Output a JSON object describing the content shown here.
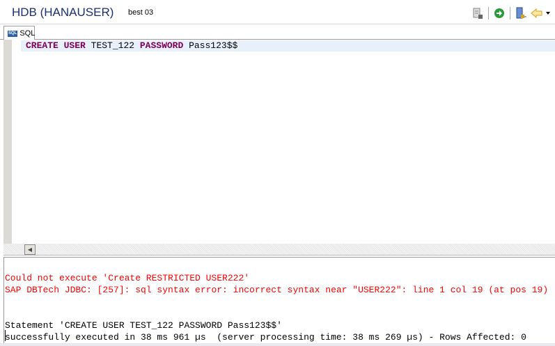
{
  "header": {
    "title": "HDB (HANAUSER)",
    "subtitle": "best 03"
  },
  "toolbar": {
    "icons": [
      "disconnect-icon",
      "execute-icon",
      "sql-console-icon",
      "back-icon",
      "dropdown-icon"
    ]
  },
  "tab": {
    "icon_label": "SQL",
    "label": "SQL"
  },
  "editor": {
    "tokens": [
      {
        "text": "CREATE",
        "kw": true
      },
      {
        "text": " "
      },
      {
        "text": "USER",
        "kw": true
      },
      {
        "text": " TEST_122 "
      },
      {
        "text": "PASSWORD",
        "kw": true
      },
      {
        "text": " Pass123$$"
      }
    ]
  },
  "console": {
    "lines": [
      {
        "text": "Could not execute 'Create RESTRICTED USER222'",
        "type": "err"
      },
      {
        "text": "SAP DBTech JDBC: [257]: sql syntax error: incorrect syntax near \"USER222\": line 1 col 19 (at pos 19)",
        "type": "err"
      },
      {
        "text": "",
        "type": "ok"
      },
      {
        "text": "",
        "type": "ok"
      },
      {
        "text": "Statement 'CREATE USER TEST_122 PASSWORD Pass123$$'",
        "type": "ok"
      },
      {
        "text": "successfully executed in 38 ms 961 µs  (server processing time: 38 ms 269 µs) - Rows Affected: 0",
        "type": "ok"
      }
    ]
  }
}
